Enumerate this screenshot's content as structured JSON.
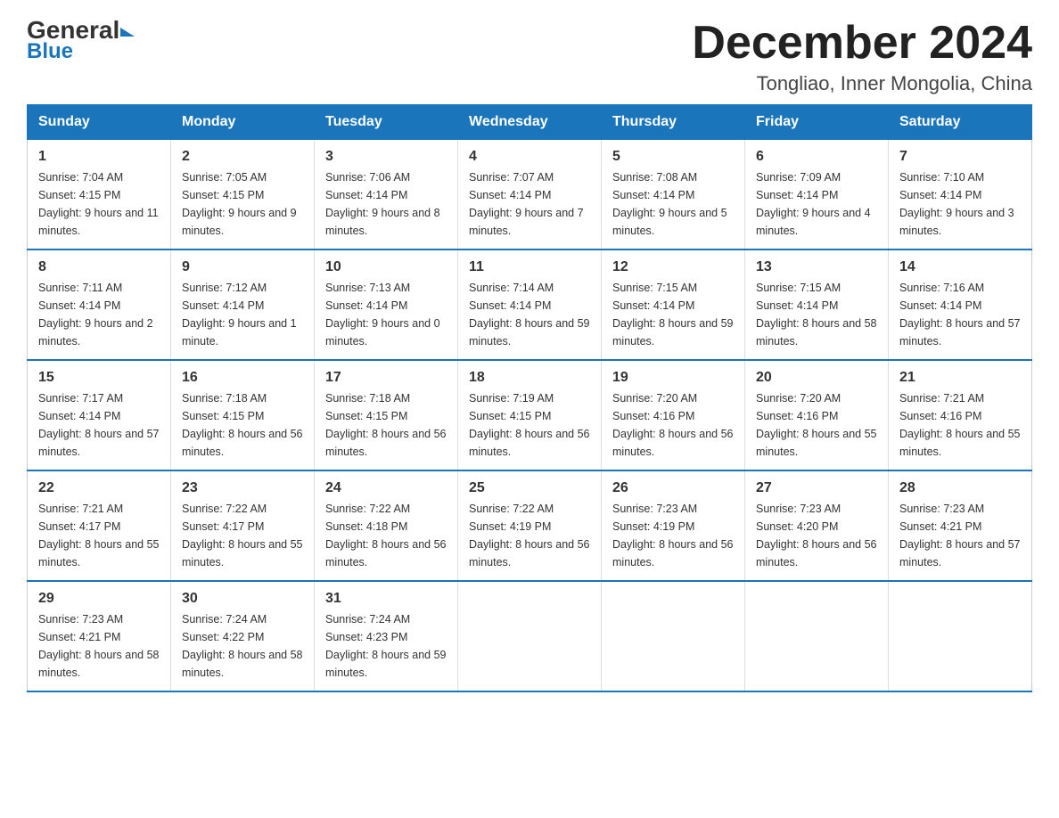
{
  "logo": {
    "general": "General",
    "blue": "Blue",
    "triangle": "▶"
  },
  "header": {
    "month": "December 2024",
    "location": "Tongliao, Inner Mongolia, China"
  },
  "days_of_week": [
    "Sunday",
    "Monday",
    "Tuesday",
    "Wednesday",
    "Thursday",
    "Friday",
    "Saturday"
  ],
  "weeks": [
    [
      {
        "day": "1",
        "sunrise": "7:04 AM",
        "sunset": "4:15 PM",
        "daylight": "9 hours and 11 minutes."
      },
      {
        "day": "2",
        "sunrise": "7:05 AM",
        "sunset": "4:15 PM",
        "daylight": "9 hours and 9 minutes."
      },
      {
        "day": "3",
        "sunrise": "7:06 AM",
        "sunset": "4:14 PM",
        "daylight": "9 hours and 8 minutes."
      },
      {
        "day": "4",
        "sunrise": "7:07 AM",
        "sunset": "4:14 PM",
        "daylight": "9 hours and 7 minutes."
      },
      {
        "day": "5",
        "sunrise": "7:08 AM",
        "sunset": "4:14 PM",
        "daylight": "9 hours and 5 minutes."
      },
      {
        "day": "6",
        "sunrise": "7:09 AM",
        "sunset": "4:14 PM",
        "daylight": "9 hours and 4 minutes."
      },
      {
        "day": "7",
        "sunrise": "7:10 AM",
        "sunset": "4:14 PM",
        "daylight": "9 hours and 3 minutes."
      }
    ],
    [
      {
        "day": "8",
        "sunrise": "7:11 AM",
        "sunset": "4:14 PM",
        "daylight": "9 hours and 2 minutes."
      },
      {
        "day": "9",
        "sunrise": "7:12 AM",
        "sunset": "4:14 PM",
        "daylight": "9 hours and 1 minute."
      },
      {
        "day": "10",
        "sunrise": "7:13 AM",
        "sunset": "4:14 PM",
        "daylight": "9 hours and 0 minutes."
      },
      {
        "day": "11",
        "sunrise": "7:14 AM",
        "sunset": "4:14 PM",
        "daylight": "8 hours and 59 minutes."
      },
      {
        "day": "12",
        "sunrise": "7:15 AM",
        "sunset": "4:14 PM",
        "daylight": "8 hours and 59 minutes."
      },
      {
        "day": "13",
        "sunrise": "7:15 AM",
        "sunset": "4:14 PM",
        "daylight": "8 hours and 58 minutes."
      },
      {
        "day": "14",
        "sunrise": "7:16 AM",
        "sunset": "4:14 PM",
        "daylight": "8 hours and 57 minutes."
      }
    ],
    [
      {
        "day": "15",
        "sunrise": "7:17 AM",
        "sunset": "4:14 PM",
        "daylight": "8 hours and 57 minutes."
      },
      {
        "day": "16",
        "sunrise": "7:18 AM",
        "sunset": "4:15 PM",
        "daylight": "8 hours and 56 minutes."
      },
      {
        "day": "17",
        "sunrise": "7:18 AM",
        "sunset": "4:15 PM",
        "daylight": "8 hours and 56 minutes."
      },
      {
        "day": "18",
        "sunrise": "7:19 AM",
        "sunset": "4:15 PM",
        "daylight": "8 hours and 56 minutes."
      },
      {
        "day": "19",
        "sunrise": "7:20 AM",
        "sunset": "4:16 PM",
        "daylight": "8 hours and 56 minutes."
      },
      {
        "day": "20",
        "sunrise": "7:20 AM",
        "sunset": "4:16 PM",
        "daylight": "8 hours and 55 minutes."
      },
      {
        "day": "21",
        "sunrise": "7:21 AM",
        "sunset": "4:16 PM",
        "daylight": "8 hours and 55 minutes."
      }
    ],
    [
      {
        "day": "22",
        "sunrise": "7:21 AM",
        "sunset": "4:17 PM",
        "daylight": "8 hours and 55 minutes."
      },
      {
        "day": "23",
        "sunrise": "7:22 AM",
        "sunset": "4:17 PM",
        "daylight": "8 hours and 55 minutes."
      },
      {
        "day": "24",
        "sunrise": "7:22 AM",
        "sunset": "4:18 PM",
        "daylight": "8 hours and 56 minutes."
      },
      {
        "day": "25",
        "sunrise": "7:22 AM",
        "sunset": "4:19 PM",
        "daylight": "8 hours and 56 minutes."
      },
      {
        "day": "26",
        "sunrise": "7:23 AM",
        "sunset": "4:19 PM",
        "daylight": "8 hours and 56 minutes."
      },
      {
        "day": "27",
        "sunrise": "7:23 AM",
        "sunset": "4:20 PM",
        "daylight": "8 hours and 56 minutes."
      },
      {
        "day": "28",
        "sunrise": "7:23 AM",
        "sunset": "4:21 PM",
        "daylight": "8 hours and 57 minutes."
      }
    ],
    [
      {
        "day": "29",
        "sunrise": "7:23 AM",
        "sunset": "4:21 PM",
        "daylight": "8 hours and 58 minutes."
      },
      {
        "day": "30",
        "sunrise": "7:24 AM",
        "sunset": "4:22 PM",
        "daylight": "8 hours and 58 minutes."
      },
      {
        "day": "31",
        "sunrise": "7:24 AM",
        "sunset": "4:23 PM",
        "daylight": "8 hours and 59 minutes."
      },
      null,
      null,
      null,
      null
    ]
  ]
}
